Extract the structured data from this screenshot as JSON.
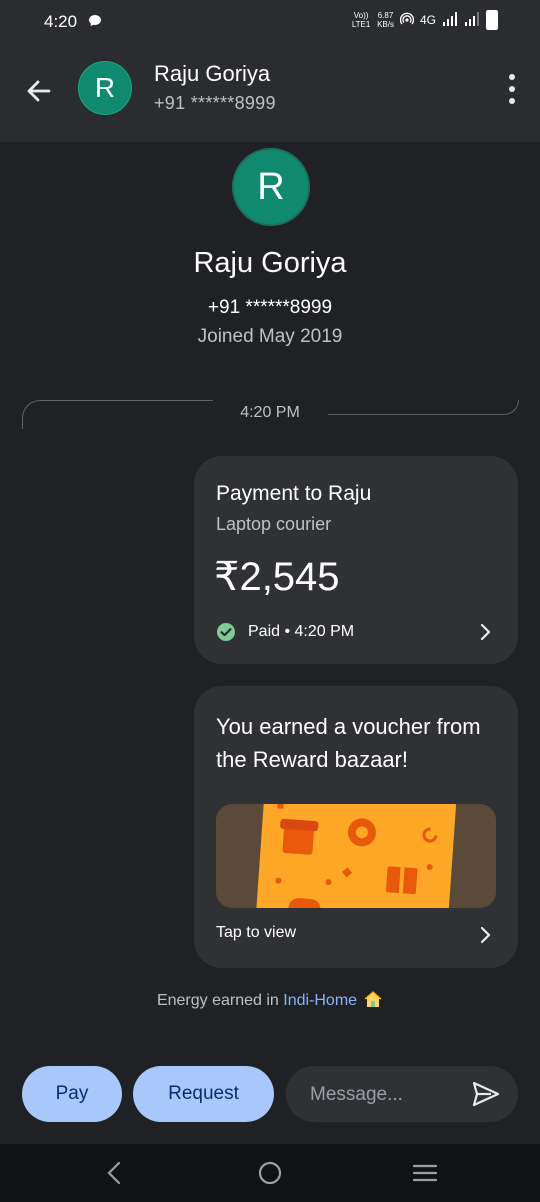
{
  "status_bar": {
    "time": "4:20",
    "volte": "Vo)) LTE1",
    "speed_value": "6.87",
    "speed_unit": "KB/s",
    "network": "4G"
  },
  "header": {
    "avatar_letter": "R",
    "name": "Raju Goriya",
    "phone": "+91 ******8999"
  },
  "profile": {
    "avatar_letter": "R",
    "name": "Raju Goriya",
    "phone": "+91 ******8999",
    "joined": "Joined May 2019"
  },
  "divider": {
    "time": "4:20 PM"
  },
  "payment": {
    "title": "Payment to Raju",
    "description": "Laptop courier",
    "amount": "₹2,545",
    "status": "Paid • 4:20 PM"
  },
  "reward": {
    "title": "You earned a voucher from the Reward bazaar!",
    "action": "Tap to view"
  },
  "energy": {
    "prefix": "Energy earned in ",
    "link": "Indi-Home"
  },
  "actions": {
    "pay_label": "Pay",
    "request_label": "Request",
    "message_placeholder": "Message..."
  },
  "colors": {
    "accent_button": "#a8c7fa",
    "avatar": "#0f8a6f",
    "paid_green": "#81c995",
    "link": "#8ab4f8"
  }
}
